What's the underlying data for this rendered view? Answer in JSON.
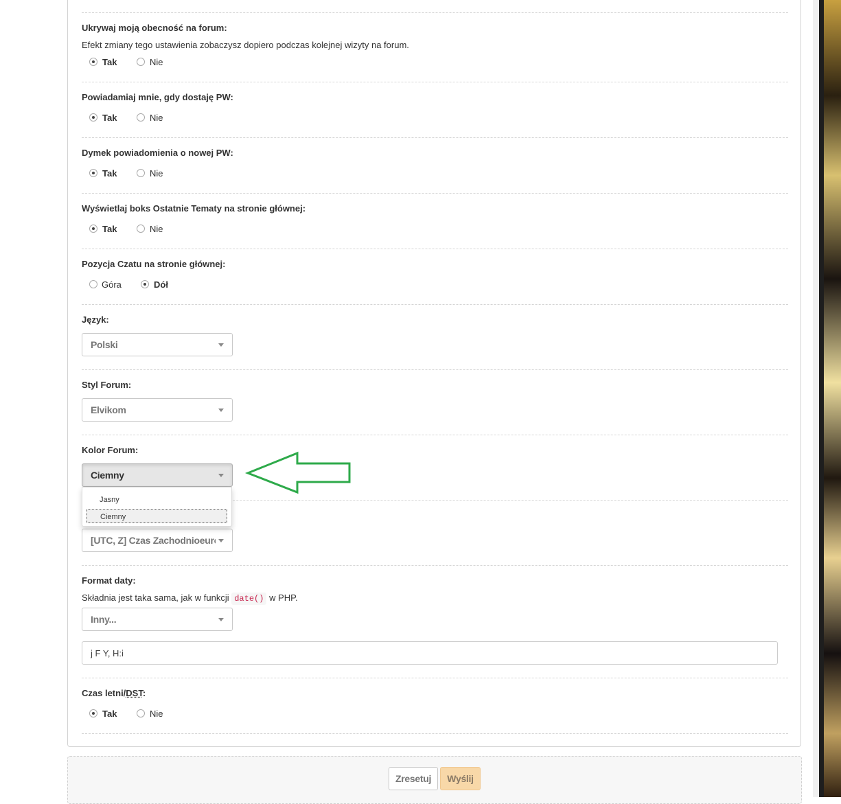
{
  "settings": {
    "hide_presence": {
      "label": "Ukrywaj moją obecność na forum:",
      "description": "Efekt zmiany tego ustawienia zobaczysz dopiero podczas kolejnej wizyty na forum.",
      "options": [
        "Tak",
        "Nie"
      ],
      "selected": "Tak"
    },
    "notify_pm": {
      "label": "Powiadamiaj mnie, gdy dostaję PW:",
      "options": [
        "Tak",
        "Nie"
      ],
      "selected": "Tak"
    },
    "pm_bubble": {
      "label": "Dymek powiadomienia o nowej PW:",
      "options": [
        "Tak",
        "Nie"
      ],
      "selected": "Tak"
    },
    "recent_topics": {
      "label": "Wyświetlaj boks Ostatnie Tematy na stronie głównej:",
      "options": [
        "Tak",
        "Nie"
      ],
      "selected": "Tak"
    },
    "chat_position": {
      "label": "Pozycja Czatu na stronie głównej:",
      "options": [
        "Góra",
        "Dół"
      ],
      "selected": "Dół"
    },
    "language": {
      "label": "Język:",
      "value": "Polski"
    },
    "forum_style": {
      "label": "Styl Forum:",
      "value": "Elvikom"
    },
    "forum_color": {
      "label": "Kolor Forum:",
      "value": "Ciemny",
      "dropdown_options": [
        "Jasny",
        "Ciemny"
      ],
      "highlighted": "Ciemny"
    },
    "timezone": {
      "value": "[UTC, Z] Czas Zachodnioeuropejski"
    },
    "date_format": {
      "label": "Format daty:",
      "description_before": "Składnia jest taka sama, jak w funkcji",
      "code": "date()",
      "description_after": "w PHP.",
      "select_value": "Inny...",
      "custom_value": "j F Y, H:i"
    },
    "dst": {
      "label_prefix": "Czas letni/",
      "label_abbr": "DST",
      "label_suffix": ":",
      "options": [
        "Tak",
        "Nie"
      ],
      "selected": "Tak"
    }
  },
  "footer": {
    "reset_label": "Zresetuj",
    "submit_label": "Wyślij"
  },
  "colors": {
    "arrow": "#2eaa4a",
    "submit_bg": "#f8d8a8",
    "code_text": "#c7254e"
  },
  "annotation": {
    "icon": "arrow-left-icon"
  }
}
